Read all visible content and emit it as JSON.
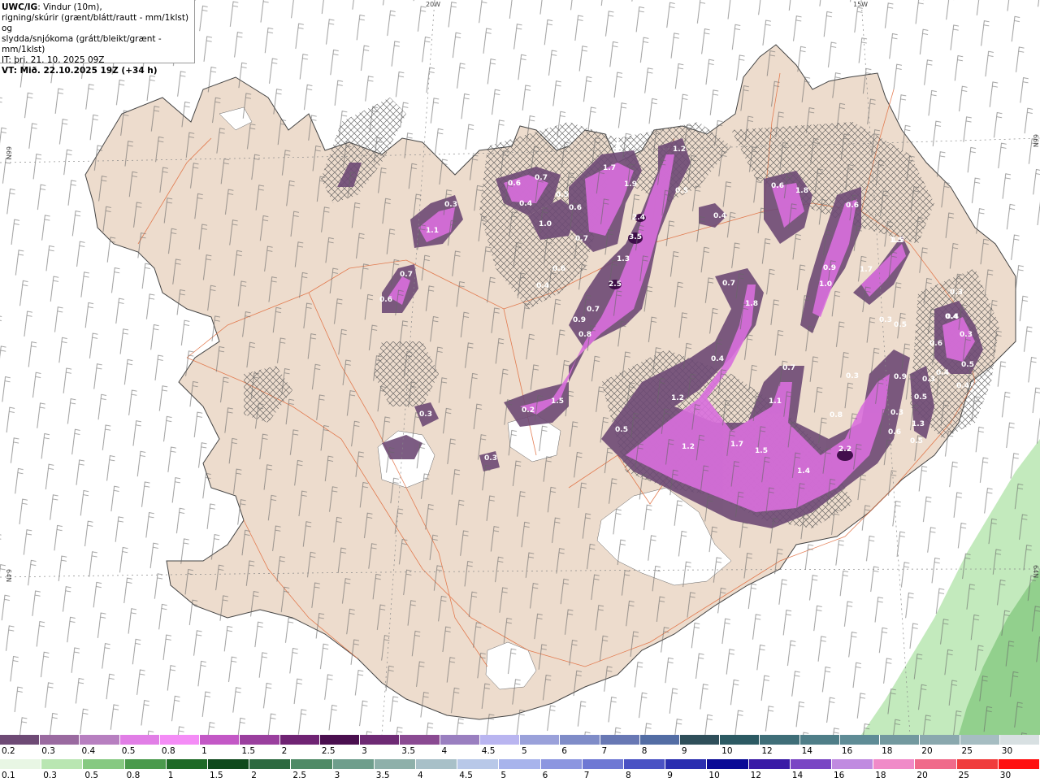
{
  "header": {
    "title_bold": "UWC/IG",
    "title_rest": ": Vindur (10m),",
    "line2": "rigning/skúrir (grænt/blátt/rautt - mm/1klst) og",
    "line3": "slydda/snjókoma (grátt/bleikt/grænt - mm/1klst)",
    "it": "IT: þri. 21. 10. 2025 09Z",
    "vt": "VT: Mið. 22.10.2025 19Z (+34 h)"
  },
  "axis_labels": {
    "top_20w": "20W",
    "top_15w": "15W",
    "left_66n": "66N",
    "right_66n": "66N",
    "left_64n": "64N",
    "right_64n": "64N"
  },
  "precip_values": [
    "1.2",
    "1.7",
    "1.9",
    "0.5",
    "2.4",
    "3.5",
    "0.4",
    "0.6",
    "1.8",
    "0.7",
    "0.6",
    "0.4",
    "0.5",
    "0.6",
    "1.0",
    "0.3",
    "1.1",
    "0.7",
    "0.7",
    "0.6",
    "0.4",
    "1.3",
    "2.5",
    "0.6",
    "0.7",
    "0.9",
    "0.8",
    "1.5",
    "0.6",
    "0.3",
    "0.4",
    "0.4",
    "0.7",
    "1.8",
    "0.9",
    "1.0",
    "1.7",
    "1.5",
    "0.3",
    "0.5",
    "0.3",
    "0.4",
    "0.5",
    "0.6",
    "0.3",
    "0.4",
    "0.4",
    "1.2",
    "0.7",
    "0.3",
    "0.9",
    "1.1",
    "0.5",
    "0.3",
    "0.8",
    "1.3",
    "0.5",
    "0.6",
    "0.5",
    "0.2",
    "0.3",
    "1.5",
    "1.2",
    "1.7",
    "1.5",
    "2.2",
    "1.4",
    "0.3"
  ],
  "legend_snow": {
    "labels": [
      "0.2",
      "0.3",
      "0.4",
      "0.5",
      "0.8",
      "1",
      "1.5",
      "2",
      "2.5",
      "3",
      "3.5",
      "4",
      "4.5",
      "5",
      "6",
      "7",
      "8",
      "9",
      "10",
      "12",
      "14",
      "16",
      "18",
      "20",
      "25",
      "30"
    ],
    "colors": [
      "#6e4a75",
      "#9a6aa0",
      "#b77fc0",
      "#e17ee6",
      "#f48cf6",
      "#c358c6",
      "#9a3f9e",
      "#6f2373",
      "#4a0f4f",
      "#6e2a74",
      "#8a4a92",
      "#9a7fc0",
      "#b9b5f0",
      "#9aa1da",
      "#7f8cc8",
      "#6878b4",
      "#536da4",
      "#2f4f5a",
      "#2c5a63",
      "#3f6e78",
      "#4f7e88",
      "#5f8c96",
      "#73999f",
      "#8aa8ae",
      "#a6bdc2",
      "#d8e0e2"
    ]
  },
  "legend_rain": {
    "labels": [
      "0.1",
      "0.3",
      "0.5",
      "0.8",
      "1",
      "1.5",
      "2",
      "2.5",
      "3",
      "3.5",
      "4",
      "4.5",
      "5",
      "6",
      "7",
      "8",
      "9",
      "10",
      "12",
      "14",
      "16",
      "18",
      "20",
      "25",
      "30"
    ],
    "colors": [
      "#e8f6e4",
      "#b9e6b2",
      "#86c981",
      "#4a9a4c",
      "#1e6a26",
      "#0f4a1c",
      "#2c6a40",
      "#4e8a66",
      "#6e9e8c",
      "#8eb0aa",
      "#a8c0c8",
      "#b8c8e8",
      "#a8b4ec",
      "#8c96e0",
      "#6e78d4",
      "#4a52c4",
      "#2a2eb0",
      "#0a0a96",
      "#3a1aa6",
      "#7a46c4",
      "#c08ae0",
      "#f08ac8",
      "#f06a8a",
      "#f03c3c",
      "#ff1010"
    ]
  }
}
